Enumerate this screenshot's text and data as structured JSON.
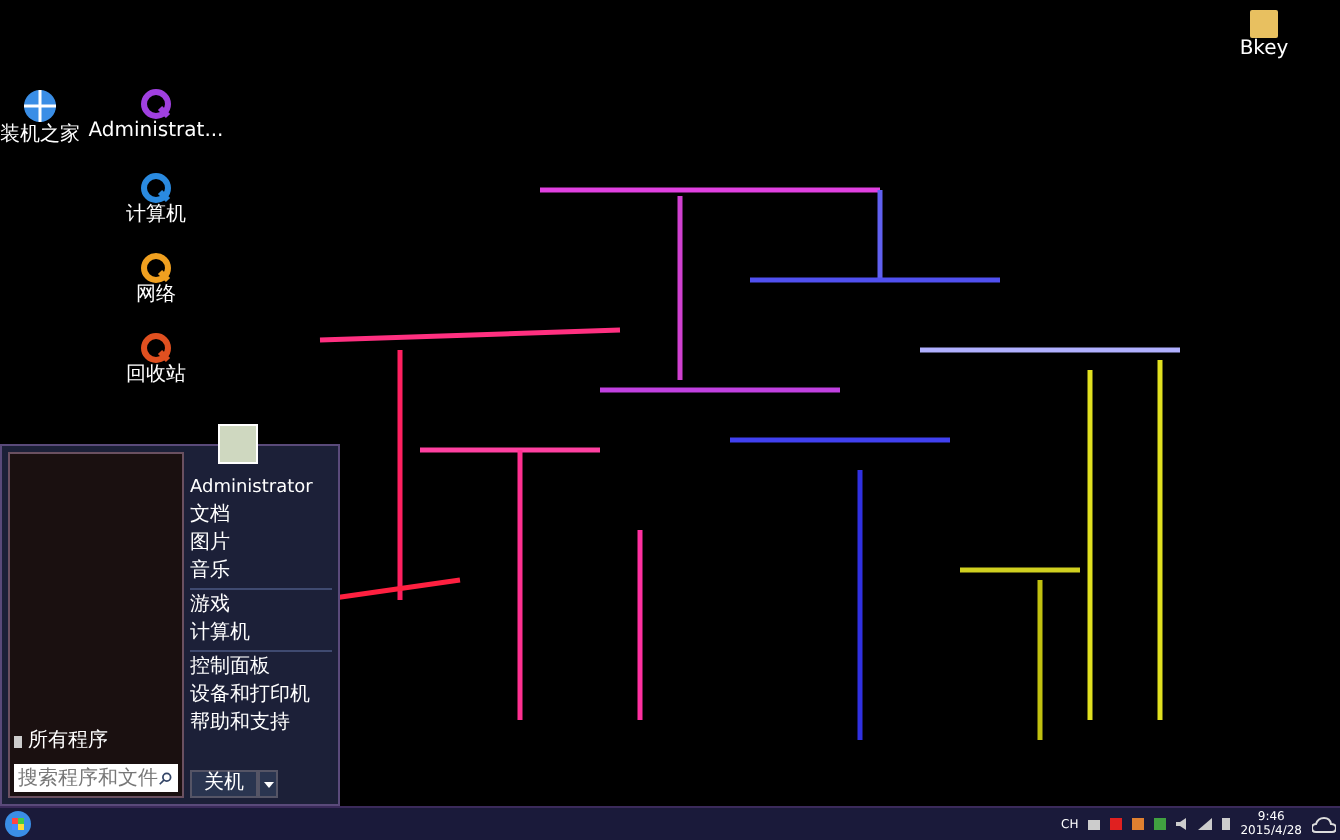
{
  "desktop_icons": [
    {
      "label": "装机之家",
      "kind": "logo",
      "color": "#3a8ee6"
    },
    {
      "label": "Administrat...",
      "kind": "qt",
      "color": "#a040e0"
    },
    {
      "label": "计算机",
      "kind": "qt",
      "color": "#2a8ae0"
    },
    {
      "label": "网络",
      "kind": "qt",
      "color": "#f0a020"
    },
    {
      "label": "回收站",
      "kind": "qt",
      "color": "#e05020"
    },
    {
      "label": "Bkey",
      "kind": "folder",
      "color": "#e8c060"
    }
  ],
  "start_menu": {
    "programs_label": "所有程序",
    "search": {
      "placeholder": "搜索程序和文件"
    },
    "user": "Administrator",
    "items": [
      {
        "label": "文档",
        "divider_after": false
      },
      {
        "label": "图片",
        "divider_after": false
      },
      {
        "label": "音乐",
        "divider_after": true
      },
      {
        "label": "游戏",
        "divider_after": false
      },
      {
        "label": "计算机",
        "divider_after": true
      },
      {
        "label": "控制面板",
        "divider_after": false
      },
      {
        "label": "设备和打印机",
        "divider_after": false
      },
      {
        "label": "帮助和支持",
        "divider_after": false
      }
    ],
    "shutdown": "关机"
  },
  "taskbar": {
    "language": "CH",
    "time": "9:46",
    "date": "2015/4/28"
  }
}
